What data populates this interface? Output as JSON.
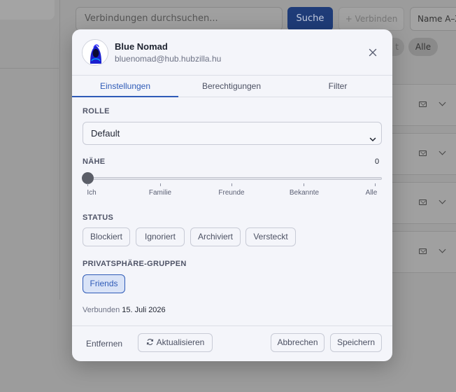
{
  "background": {
    "search_placeholder": "Verbindungen durchsuchen...",
    "search_button": "Suche",
    "connect_button": "+ Verbinden",
    "sort_select": "Name A–Z",
    "filter_chip_partial": "t",
    "filter_chip_all": "Alle"
  },
  "modal": {
    "name": "Blue Nomad",
    "handle": "bluenomad@hub.hubzilla.hu",
    "tabs": [
      "Einstellungen",
      "Berechtigungen",
      "Filter"
    ],
    "active_tab": "Einstellungen",
    "role": {
      "label": "ROLLE",
      "value": "Default"
    },
    "closeness": {
      "label": "NÄHE",
      "value": "0",
      "ticks": [
        "Ich",
        "Familie",
        "Freunde",
        "Bekannte",
        "Alle"
      ]
    },
    "status": {
      "label": "STATUS",
      "options": [
        "Blockiert",
        "Ignoriert",
        "Archiviert",
        "Versteckt"
      ]
    },
    "privacy_groups": {
      "label": "PRIVATSPHÄRE-GRUPPEN",
      "options": [
        "Friends"
      ],
      "selected": "Friends"
    },
    "connected": {
      "prefix": "Verbunden",
      "date": "15. Juli 2026"
    },
    "footer": {
      "remove": "Entfernen",
      "refresh": "Aktualisieren",
      "cancel": "Abbrechen",
      "save": "Speichern"
    }
  },
  "colors": {
    "accent": "#2f5bb7",
    "overlay": "#9c9c9c",
    "modal_bg": "#f4f5fa"
  },
  "icons": [
    "close-icon",
    "chevron-down-icon",
    "refresh-icon",
    "mail-icon"
  ]
}
